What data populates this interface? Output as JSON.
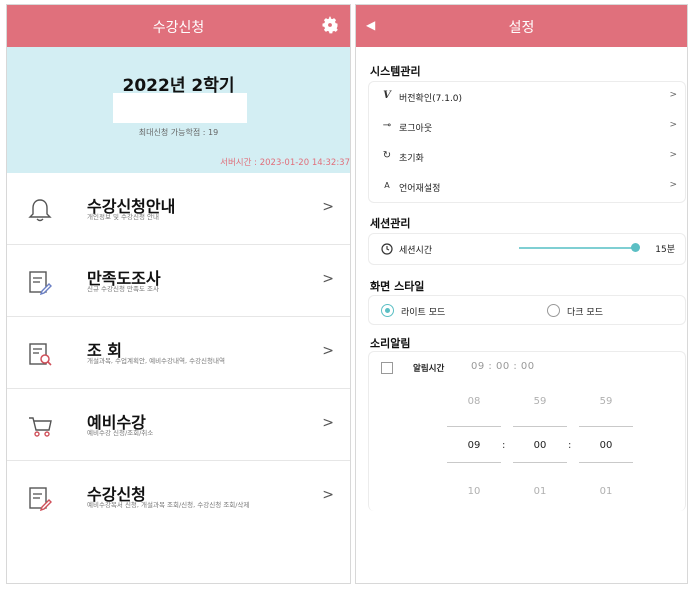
{
  "left": {
    "title": "수강신청",
    "semester_title": "2022년 2학기",
    "credits": "최대신청 가능학점 : 19",
    "server_time": "서버시간 : 2023-01-20 14:32:37",
    "menu": [
      {
        "title": "수강신청안내",
        "sub": "개인정보 및 수강신청 안내",
        "icon": "bell-icon"
      },
      {
        "title": "만족도조사",
        "sub": "신규 수강신청 만족도 조사",
        "icon": "survey-edit-icon"
      },
      {
        "title": "조  회",
        "sub": "개설과목, 수업계획안, 예비수강내역, 수강신청내역",
        "icon": "document-search-icon"
      },
      {
        "title": "예비수강",
        "sub": "예비수강 신청/조회/취소",
        "icon": "cart-icon"
      },
      {
        "title": "수강신청",
        "sub": "예비수강목서 신청, 개설과목 조회/신청, 수강신청 조회/삭제",
        "icon": "document-edit-icon"
      }
    ]
  },
  "right": {
    "back": "◀",
    "title": "설정",
    "system": {
      "title": "시스템관리",
      "items": [
        {
          "icon_glyph": "V",
          "label": "버전확인(7.1.0)"
        },
        {
          "icon_glyph": "⊸",
          "label": "로그아웃"
        },
        {
          "icon_glyph": "↻",
          "label": "초기화"
        },
        {
          "icon_glyph": "A",
          "label": "언어재설정"
        }
      ]
    },
    "session": {
      "title": "세션관리",
      "label": "세션시간",
      "value": "15분",
      "level": 1.0
    },
    "style": {
      "title": "화면 스타일",
      "light": "라이트 모드",
      "dark": "다크 모드",
      "selected": "light"
    },
    "sound": {
      "title": "소리알림",
      "alarm_label": "알림시간",
      "alarm_time": "09 : 00 : 00",
      "picker": {
        "prev": [
          "08",
          "59",
          "59"
        ],
        "current": [
          "09",
          "00",
          "00"
        ],
        "next": [
          "10",
          "01",
          "01"
        ],
        "sep": ":"
      }
    }
  },
  "colors": {
    "accent": "#e0707c",
    "teal": "#5bbfc4",
    "banner": "#d3eef3"
  }
}
